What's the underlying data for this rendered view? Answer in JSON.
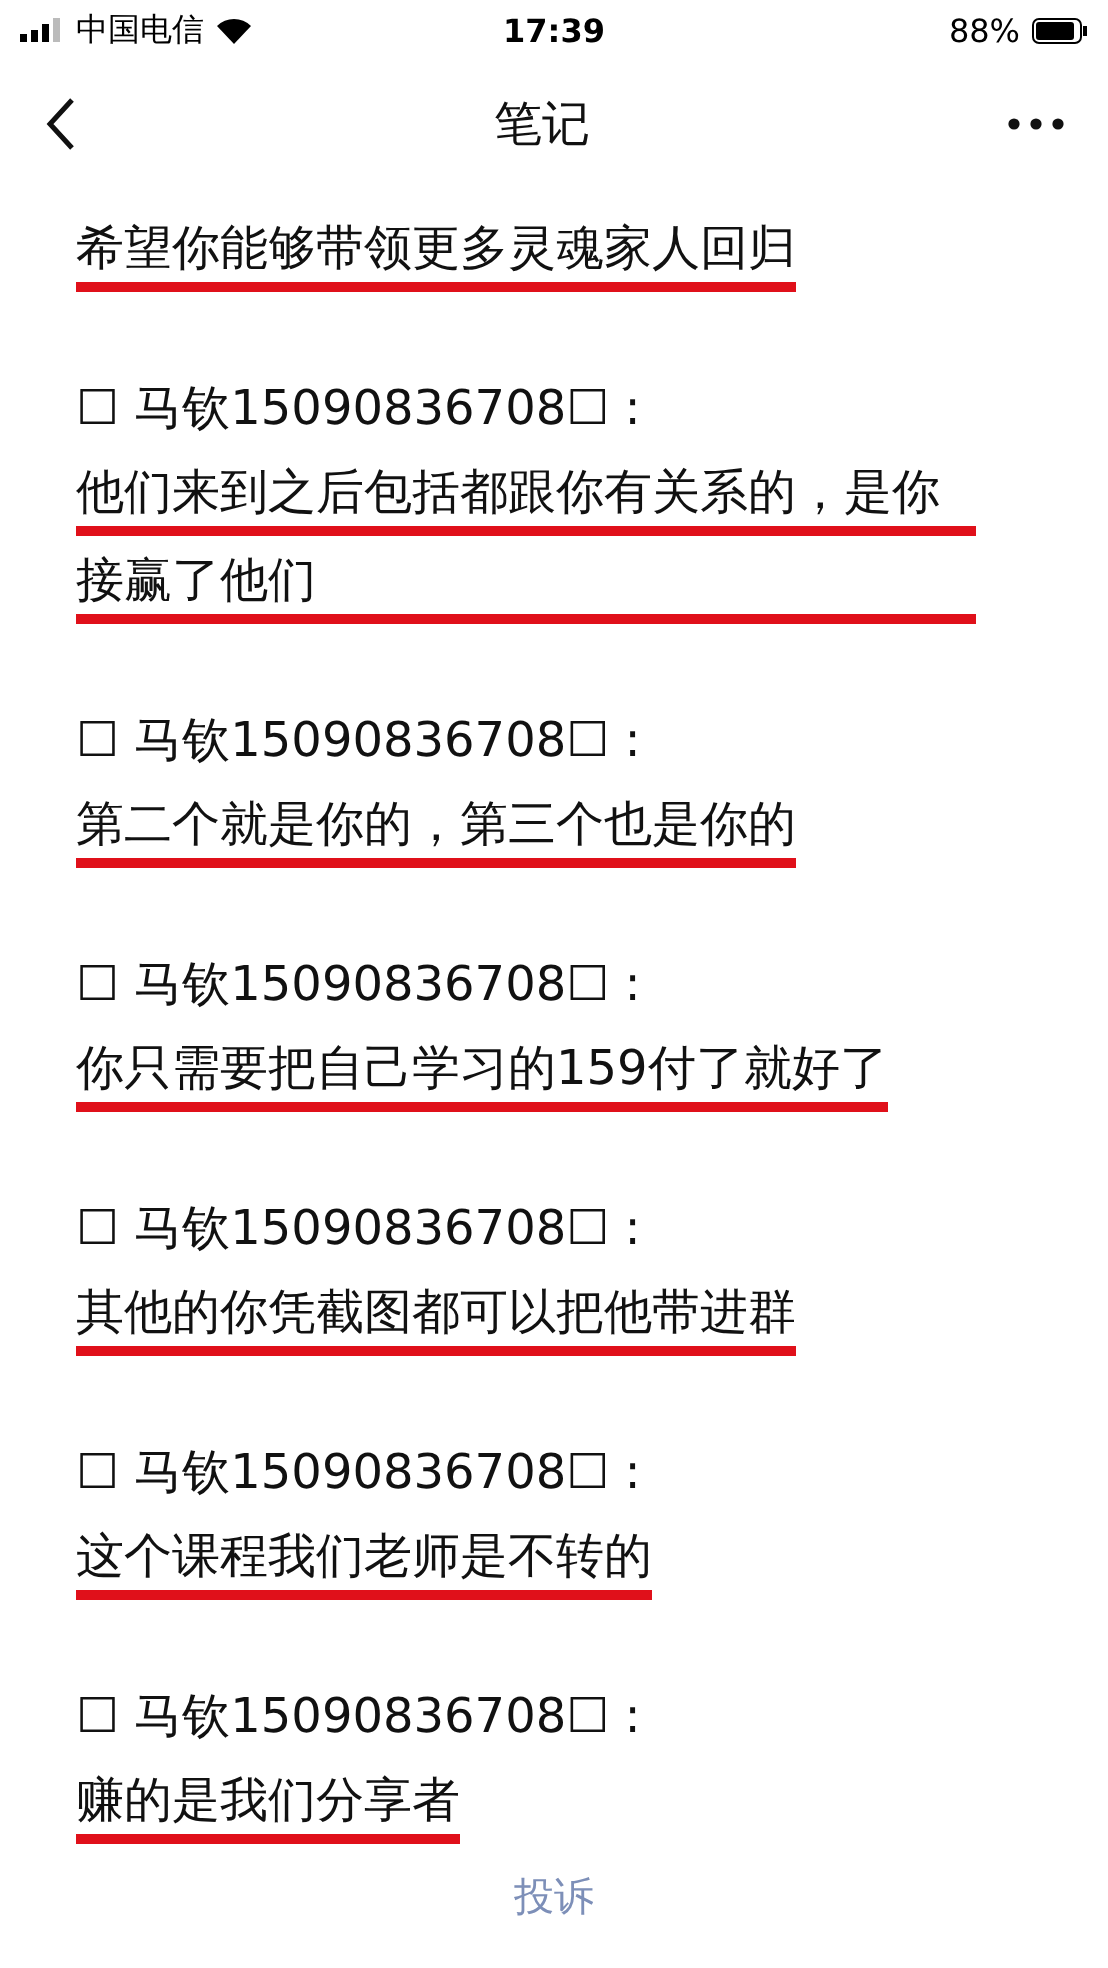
{
  "status_bar": {
    "carrier": "中国电信",
    "time": "17:39",
    "battery": "88%"
  },
  "nav_bar": {
    "title": "笔记"
  },
  "entries": [
    {
      "message": "希望你能够带领更多灵魂家人回归",
      "underlined": true
    },
    {
      "header": "☐ 马钦15090836708☐ :",
      "message": "他们来到之后包括都跟你有关系的，是你接赢了他们",
      "underlined": true
    },
    {
      "header": "☐ 马钦15090836708☐ :",
      "message": "第二个就是你的，第三个也是你的",
      "underlined": true
    },
    {
      "header": "☐ 马钦15090836708☐ :",
      "message": "你只需要把自己学习的159付了就好了",
      "underlined": true
    },
    {
      "header": "☐ 马钦15090836708☐ :",
      "message": "其他的你凭截图都可以把他带进群",
      "underlined": true
    },
    {
      "header": "☐ 马钦15090836708☐ :",
      "message": "这个课程我们老师是不转的",
      "underlined": true
    },
    {
      "header": "☐ 马钦15090836708☐ :",
      "message": "赚的是我们分享者",
      "underlined": true
    }
  ],
  "footer": {
    "link": "投诉"
  }
}
